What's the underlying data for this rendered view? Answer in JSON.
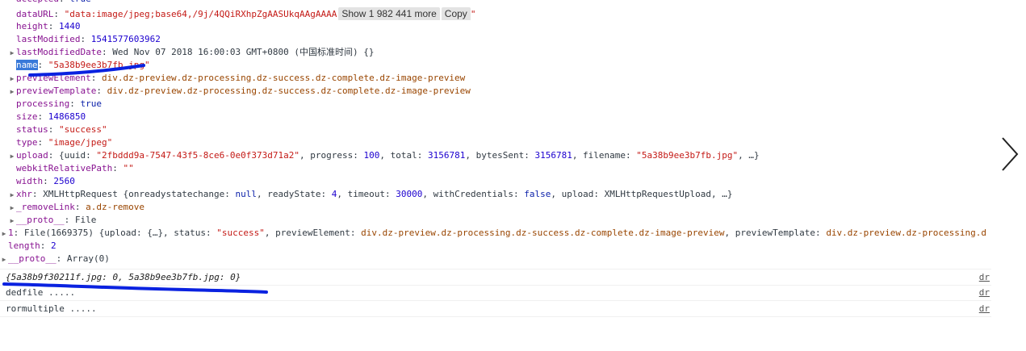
{
  "console": {
    "data_url": {
      "key": "dataURL",
      "value": "\"data:image/jpeg;base64,/9j/4QQiRXhpZgAASUkqAAgAAAA",
      "show_more": "Show 1 982 441 more",
      "copy": "Copy",
      "tail": "\""
    },
    "height": {
      "key": "height",
      "value": "1440"
    },
    "last_modified": {
      "key": "lastModified",
      "value": "1541577603962"
    },
    "last_modified_date": {
      "key": "lastModifiedDate",
      "value": "Wed Nov 07 2018 16:00:03 GMT+0800 (中国标准时间) {}"
    },
    "name": {
      "key": "name",
      "value": "\"5a38b9ee3b7fb.jpg\""
    },
    "preview_element": {
      "key": "previewElement",
      "value": "div.dz-preview.dz-processing.dz-success.dz-complete.dz-image-preview"
    },
    "preview_template": {
      "key": "previewTemplate",
      "value": "div.dz-preview.dz-processing.dz-success.dz-complete.dz-image-preview"
    },
    "processing": {
      "key": "processing",
      "value": "true"
    },
    "size": {
      "key": "size",
      "value": "1486850"
    },
    "status": {
      "key": "status",
      "value": "\"success\""
    },
    "type": {
      "key": "type",
      "value": "\"image/jpeg\""
    },
    "upload": {
      "key": "upload",
      "open": "{uuid: ",
      "uuid": "\"2fbddd9a-7547-43f5-8ce6-0e0f373d71a2\"",
      "progress_k": ", progress: ",
      "progress": "100",
      "total_k": ", total: ",
      "total": "3156781",
      "bytes_k": ", bytesSent: ",
      "bytes": "3156781",
      "filename_k": ", filename: ",
      "filename": "\"5a38b9ee3b7fb.jpg\"",
      "close": ", …}"
    },
    "webkit": {
      "key": "webkitRelativePath",
      "value": "\"\""
    },
    "width": {
      "key": "width",
      "value": "2560"
    },
    "xhr": {
      "key": "xhr",
      "p1": "XMLHttpRequest {onreadystatechange: ",
      "v1": "null",
      "p2": ", readyState: ",
      "v2": "4",
      "p3": ", timeout: ",
      "v3": "30000",
      "p4": ", withCredentials: ",
      "v4": "false",
      "p5": ", upload: XMLHttpRequestUpload, …}"
    },
    "remove_link": {
      "key": "_removeLink",
      "value": "a.dz-remove"
    },
    "proto_file": {
      "key": "__proto__",
      "value": "File"
    },
    "file1": {
      "key": "1",
      "p1": "File(1669375) {upload: {…}, status: ",
      "status": "\"success\"",
      "p2": ", previewElement: ",
      "pe": "div.dz-preview.dz-processing.dz-success.dz-complete.dz-image-preview",
      "p3": ", previewTemplate: ",
      "pt": "div.dz-preview.dz-processing.d"
    },
    "length": {
      "key": "length",
      "value": "2"
    },
    "proto_array": {
      "key": "__proto__",
      "value": "Array(0)"
    },
    "messages": [
      {
        "text": "{5a38b9f30211f.jpg: 0, 5a38b9ee3b7fb.jpg: 0}",
        "source": "dr"
      },
      {
        "text": "dedfile .....",
        "source": "dr"
      },
      {
        "text": "rormultiple .....",
        "source": "dr"
      }
    ]
  },
  "annotation_color": "#0a22e0",
  "icons": {
    "next": "chevron-right-icon"
  }
}
